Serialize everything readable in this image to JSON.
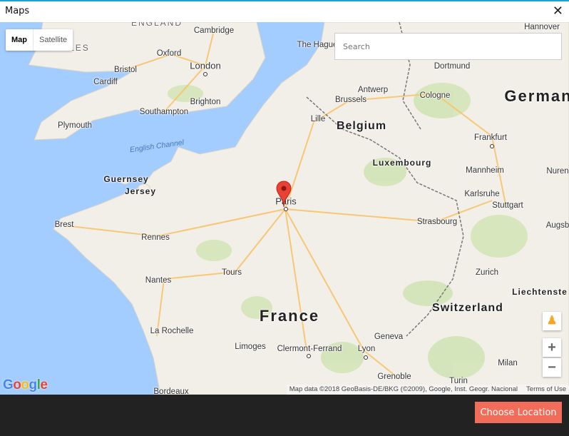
{
  "window": {
    "title": "Maps",
    "close_icon": "close-icon"
  },
  "map": {
    "type_control": {
      "map": "Map",
      "satellite": "Satellite",
      "selected": "Map"
    },
    "search": {
      "placeholder": "Search",
      "value": ""
    },
    "regions": [
      "ENGLAND",
      "WALES"
    ],
    "countries": [
      "Belgium",
      "Luxembourg",
      "Switzerland",
      "Liechtenste",
      "German",
      "France"
    ],
    "islands": [
      "Guernsey",
      "Jersey"
    ],
    "sea": "English Channel",
    "cities": [
      "Cambridge",
      "The Hague",
      "Hannover",
      "Oxford",
      "London",
      "Dortmund",
      "Bristol",
      "Cardiff",
      "Antwerp",
      "Cologne",
      "Brussels",
      "Southampton",
      "Brighton",
      "Lille",
      "Plymouth",
      "Frankfurt",
      "Mannheim",
      "Nuren",
      "Karlsruhe",
      "Paris",
      "Stuttgart",
      "Brest",
      "Strasbourg",
      "Augsb",
      "Rennes",
      "Tours",
      "Zurich",
      "Nantes",
      "La Rochelle",
      "Geneva",
      "Limoges",
      "Clermont-Ferrand",
      "Lyon",
      "Milan",
      "Grenoble",
      "Turin",
      "Bordeaux"
    ],
    "marker": {
      "location": "Paris",
      "color": "#e94235"
    },
    "zoom_in": "+",
    "zoom_out": "−",
    "attribution": "Map data ©2018 GeoBasis-DE/BKG (©2009), Google, Inst. Geogr. Nacional",
    "terms": "Terms of Use",
    "logo": "Google",
    "colors": {
      "water": "#a3ccff",
      "land": "#f2efe9",
      "park": "#c8e0a8",
      "road": "#f8c36a"
    }
  },
  "footer": {
    "choose_label": "Choose Location",
    "button_color": "#f26c5a"
  }
}
